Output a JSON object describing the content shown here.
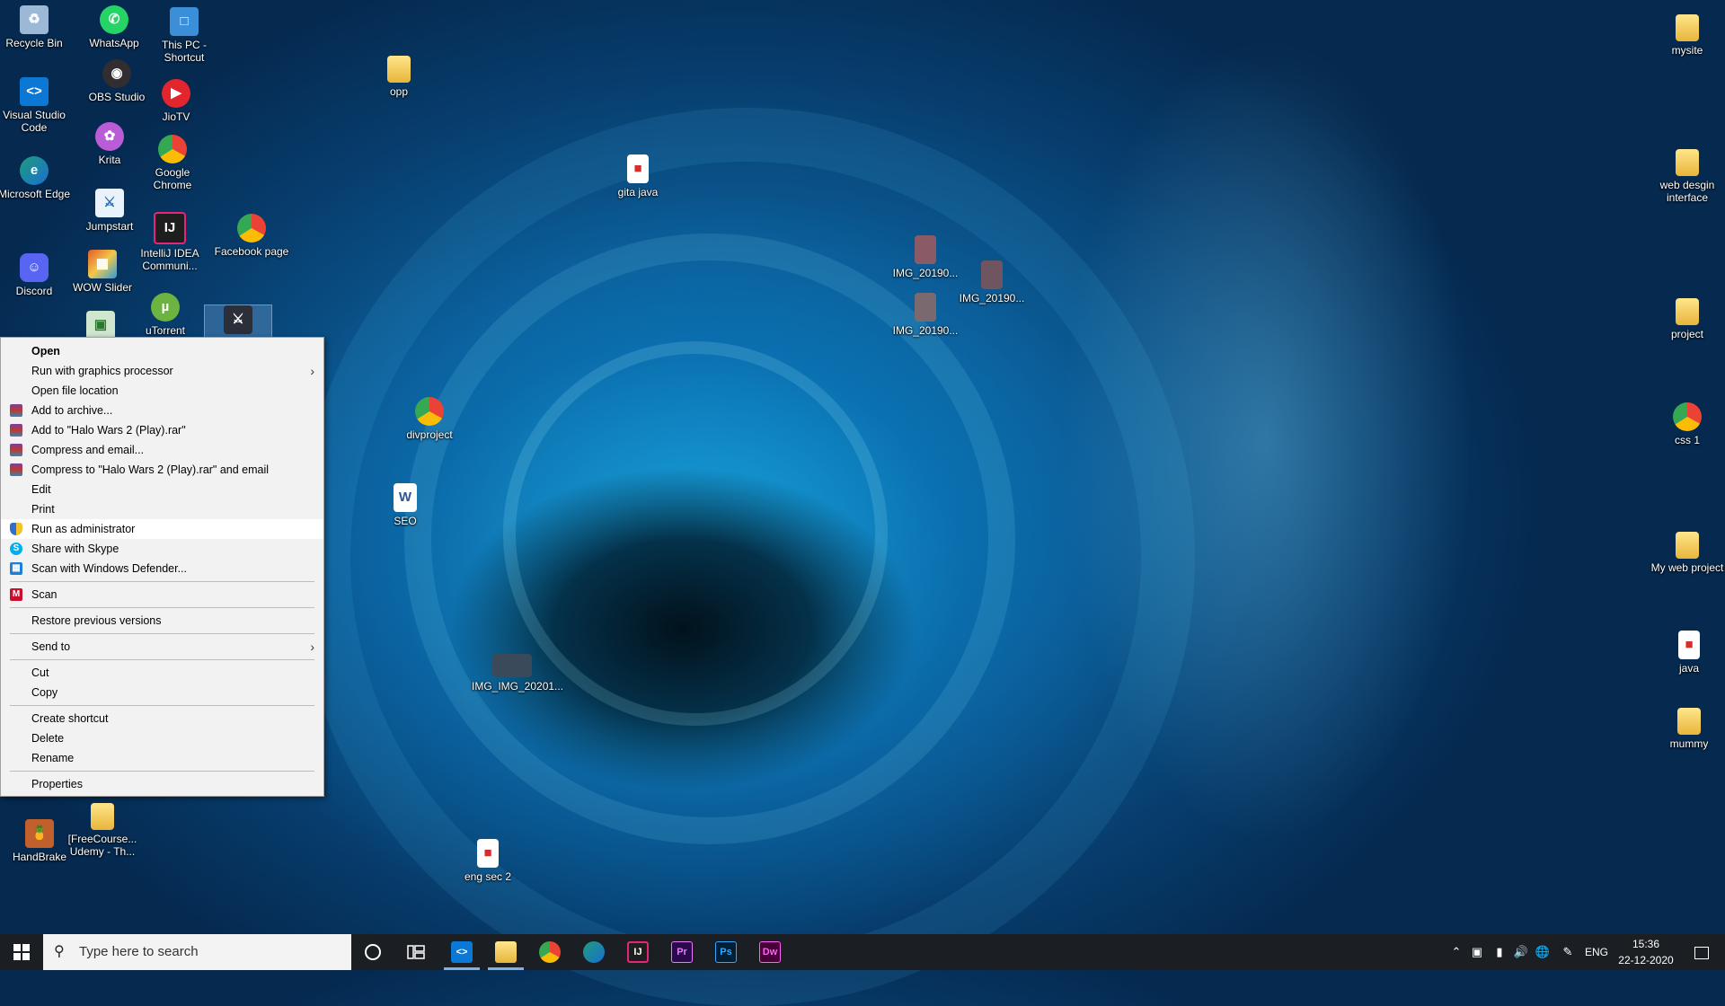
{
  "desktop": {
    "icons": [
      {
        "label": "Recycle Bin",
        "icon": "recycle-bin-icon",
        "color": "#9bb8d6"
      },
      {
        "label": "WhatsApp",
        "icon": "whatsapp-icon",
        "color": "#25d366"
      },
      {
        "label": "This PC - Shortcut",
        "icon": "this-pc-icon",
        "color": "#3a8fd8"
      },
      {
        "label": "OBS Studio",
        "icon": "obs-icon",
        "color": "#302e31"
      },
      {
        "label": "Visual Studio Code",
        "icon": "vscode-icon",
        "color": "#0a78d4"
      },
      {
        "label": "JioTV",
        "icon": "jiotv-icon",
        "color": "#e3262d"
      },
      {
        "label": "Krita",
        "icon": "krita-icon",
        "color": "#b95cd6"
      },
      {
        "label": "Google Chrome",
        "icon": "chrome-icon",
        "color": "#34a853"
      },
      {
        "label": "Microsoft Edge",
        "icon": "edge-icon",
        "color": "#1f9c7d"
      },
      {
        "label": "Jumpstart",
        "icon": "jumpstart-icon",
        "color": "#2a6fb5"
      },
      {
        "label": "IntelliJ IDEA Communi...",
        "icon": "intellij-icon",
        "color": "#1e1e1e"
      },
      {
        "label": "Facebook page",
        "icon": "chrome-icon",
        "color": "#34a853"
      },
      {
        "label": "Discord",
        "icon": "discord-icon",
        "color": "#5865f2"
      },
      {
        "label": "WOW Slider",
        "icon": "wowslider-icon",
        "color": "#e05a2a"
      },
      {
        "label": "uTorrent",
        "icon": "utorrent-icon",
        "color": "#6cb33f"
      },
      {
        "label": "opp",
        "icon": "folder-icon",
        "color": "#e8b53b"
      },
      {
        "label": "gita java",
        "icon": "pdf-icon",
        "color": "#d32f2f"
      },
      {
        "label": "IMG_20190...",
        "icon": "image-icon",
        "color": "#8a5a66"
      },
      {
        "label": "IMG_20190...",
        "icon": "image-icon",
        "color": "#6e5560"
      },
      {
        "label": "IMG_20190...",
        "icon": "image-icon",
        "color": "#7a6a70"
      },
      {
        "label": "divproject",
        "icon": "chrome-icon",
        "color": "#34a853"
      },
      {
        "label": "SEO",
        "icon": "word-doc-icon",
        "color": "#2b5797"
      },
      {
        "label": "IMG_IMG_20201...",
        "icon": "image-icon",
        "color": "#3a4a5a"
      },
      {
        "label": "HandBrake",
        "icon": "handbrake-icon",
        "color": "#c2602d"
      },
      {
        "label": "[FreeCourse... Udemy - Th...",
        "icon": "folder-icon",
        "color": "#e8b53b"
      },
      {
        "label": "eng sec 2",
        "icon": "pdf-icon",
        "color": "#d32f2f"
      },
      {
        "label": "mysite",
        "icon": "folder-icon",
        "color": "#e8b53b"
      },
      {
        "label": "web desgin interface",
        "icon": "folder-icon",
        "color": "#e8b53b"
      },
      {
        "label": "project",
        "icon": "folder-icon",
        "color": "#e8b53b"
      },
      {
        "label": "css 1",
        "icon": "chrome-icon",
        "color": "#34a853"
      },
      {
        "label": "My web project",
        "icon": "folder-icon",
        "color": "#e8b53b"
      },
      {
        "label": "java",
        "icon": "pdf-icon",
        "color": "#d32f2f"
      },
      {
        "label": "mummy",
        "icon": "folder-icon",
        "color": "#e8b53b"
      }
    ]
  },
  "context_menu": {
    "items": [
      {
        "label": "Open",
        "bold": true
      },
      {
        "label": "Run with graphics processor",
        "submenu": true
      },
      {
        "label": "Open file location"
      },
      {
        "label": "Add to archive...",
        "icon": "winrar-icon"
      },
      {
        "label": "Add to \"Halo Wars 2 (Play).rar\"",
        "icon": "winrar-icon"
      },
      {
        "label": "Compress and email...",
        "icon": "winrar-icon"
      },
      {
        "label": "Compress to \"Halo Wars 2 (Play).rar\" and email",
        "icon": "winrar-icon"
      },
      {
        "label": "Edit"
      },
      {
        "label": "Print"
      },
      {
        "label": "Run as administrator",
        "icon": "shield-icon",
        "highlighted": true
      },
      {
        "label": "Share with Skype",
        "icon": "skype-icon"
      },
      {
        "label": "Scan with Windows Defender...",
        "icon": "defender-icon"
      },
      {
        "label": "Scan",
        "icon": "mcafee-icon"
      },
      {
        "label": "Restore previous versions"
      },
      {
        "label": "Send to",
        "submenu": true
      },
      {
        "label": "Cut"
      },
      {
        "label": "Copy"
      },
      {
        "label": "Create shortcut"
      },
      {
        "label": "Delete"
      },
      {
        "label": "Rename"
      },
      {
        "label": "Properties"
      }
    ],
    "submenu_arrow": "›"
  },
  "taskbar": {
    "search_placeholder": "Type here to search",
    "pinned_apps": [
      {
        "name": "Visual Studio Code",
        "icon": "vscode-icon",
        "short": "<>",
        "color": "#0a78d4",
        "active": true
      },
      {
        "name": "File Explorer",
        "icon": "folder-icon",
        "short": "",
        "color": "#e8b53b",
        "active": true
      },
      {
        "name": "Google Chrome",
        "icon": "chrome-icon",
        "short": "",
        "color": "#34a853"
      },
      {
        "name": "Microsoft Edge",
        "icon": "edge-icon",
        "short": "",
        "color": "#1f9c7d"
      },
      {
        "name": "IntelliJ IDEA",
        "icon": "intellij-icon",
        "short": "IJ",
        "color": "#1e1e1e"
      },
      {
        "name": "Premiere Pro",
        "icon": "premiere-icon",
        "short": "Pr",
        "color": "#2a0a4a"
      },
      {
        "name": "Photoshop",
        "icon": "photoshop-icon",
        "short": "Ps",
        "color": "#001e36"
      },
      {
        "name": "Dreamweaver",
        "icon": "dreamweaver-icon",
        "short": "Dw",
        "color": "#470137"
      }
    ],
    "tray": {
      "language": "ENG",
      "time": "15:36",
      "date": "22-12-2020"
    }
  }
}
